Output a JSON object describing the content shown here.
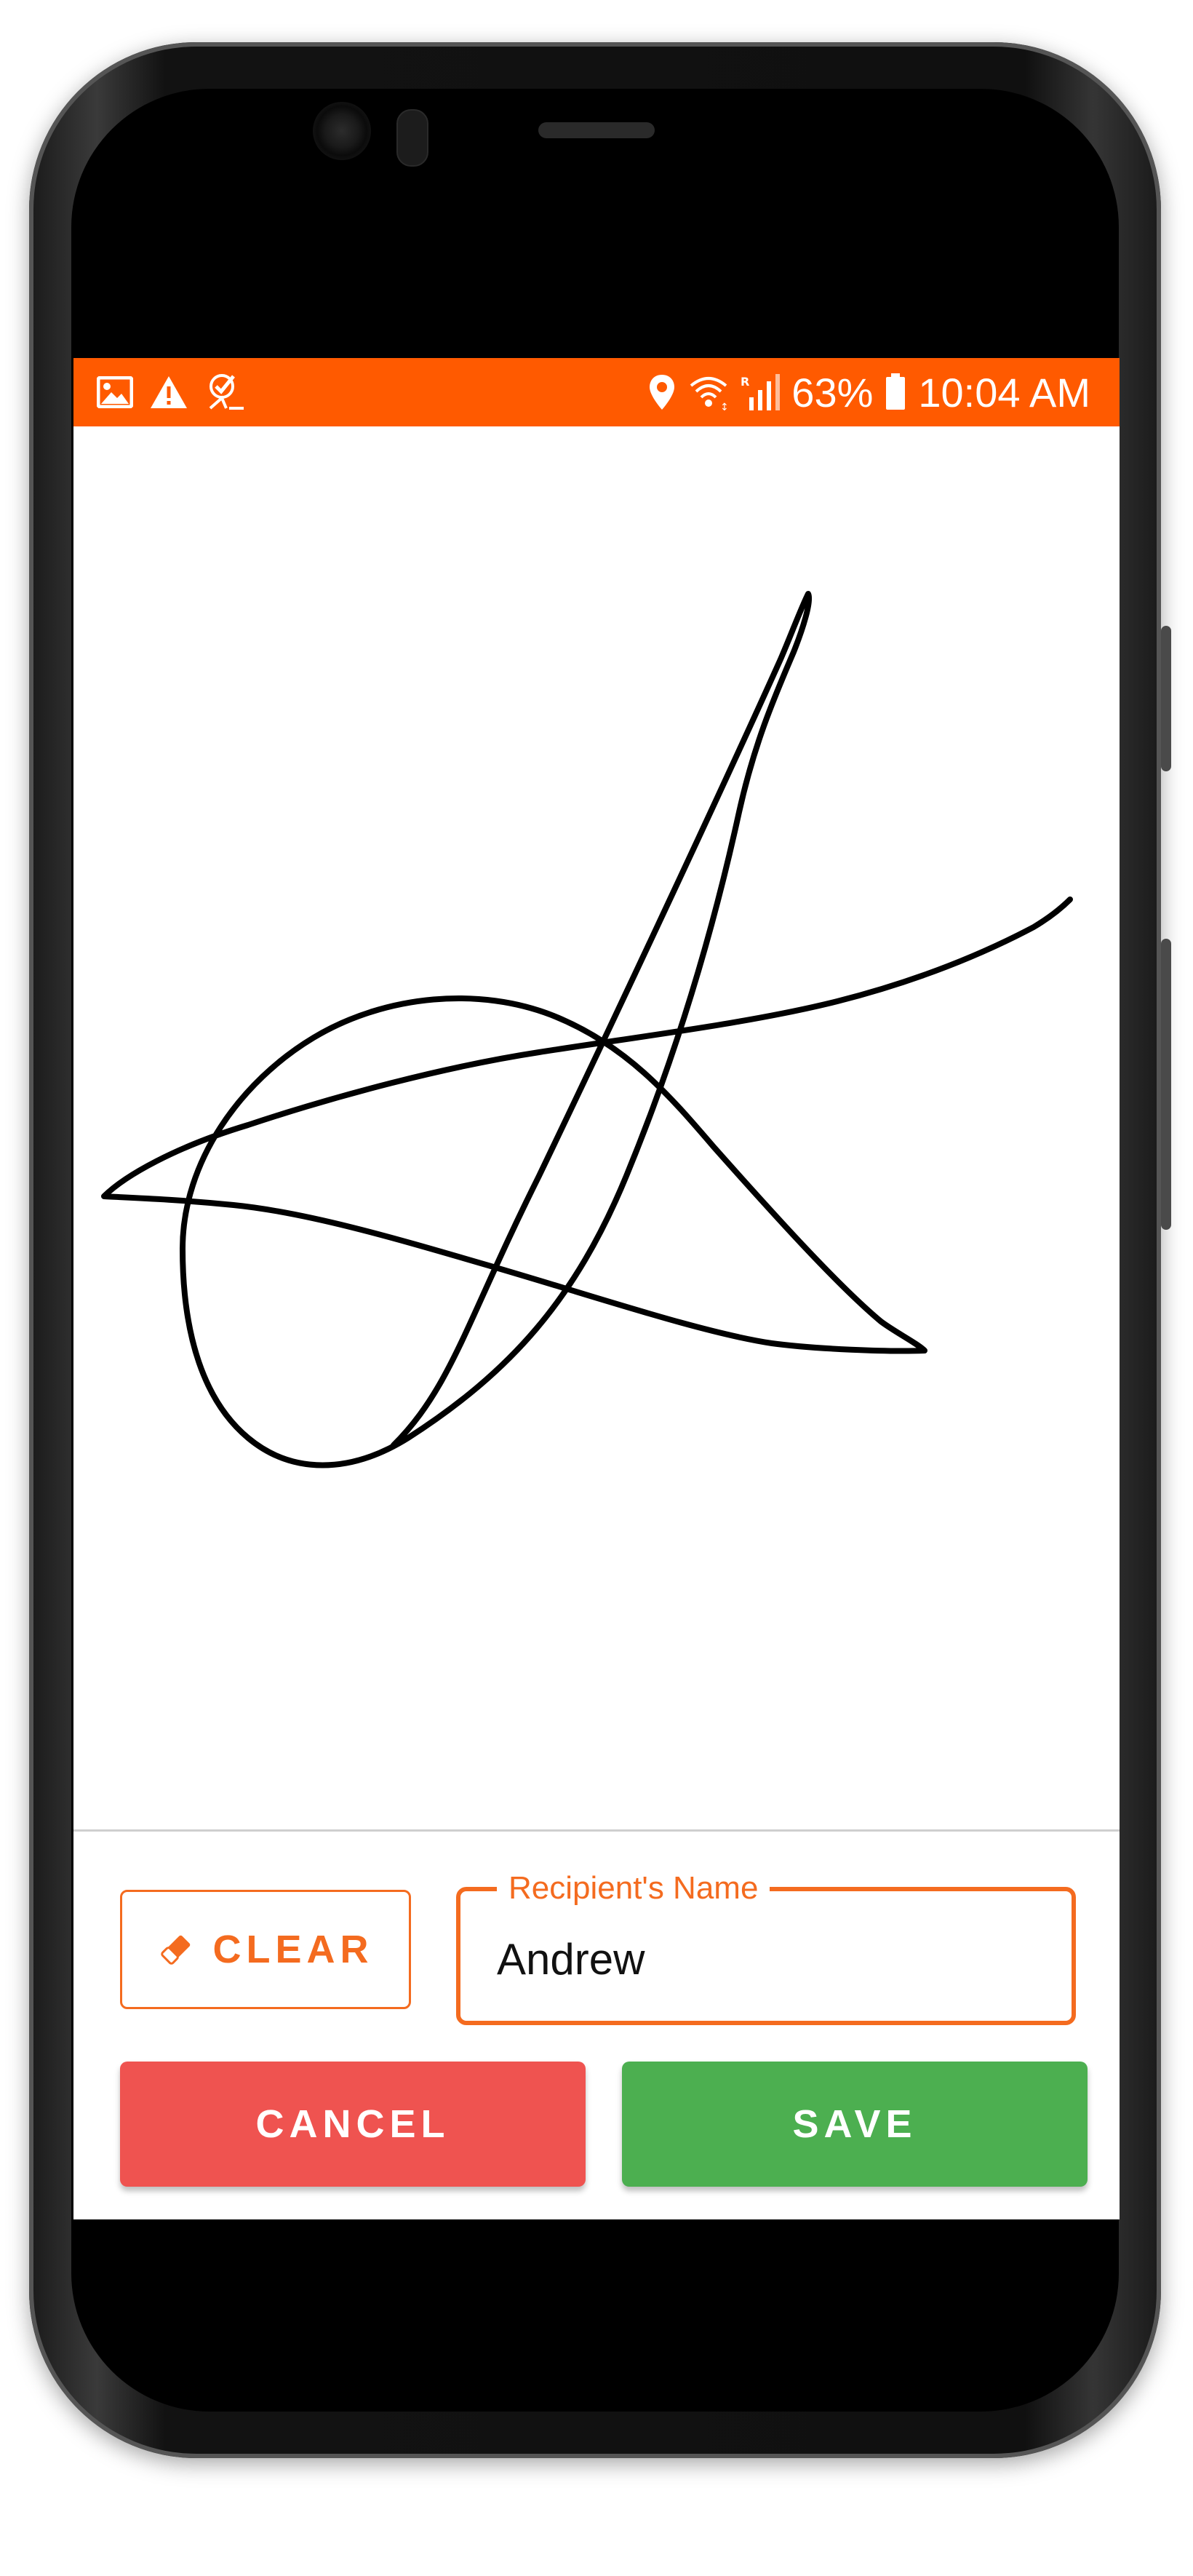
{
  "status_bar": {
    "battery": "63%",
    "time": "10:04 AM",
    "left_icons": [
      "image-icon",
      "warning-icon",
      "task-check-icon"
    ],
    "right_icons": [
      "location-icon",
      "wifi-icon",
      "signal-icon",
      "battery-icon"
    ],
    "color": "#ff5a00"
  },
  "signature": {
    "stroke_color": "#000000"
  },
  "controls": {
    "clear_label": "CLEAR",
    "recipient_label": "Recipient's Name",
    "recipient_value": "Andrew",
    "cancel_label": "CANCEL",
    "save_label": "SAVE"
  },
  "colors": {
    "accent": "#f46b1f",
    "cancel": "#ef5350",
    "save": "#4caf50"
  }
}
